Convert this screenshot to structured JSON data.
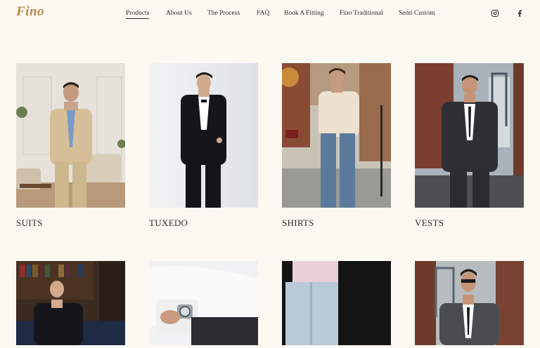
{
  "brand": {
    "logo_text": "Fino"
  },
  "nav": {
    "items": [
      {
        "label": "Products",
        "active": true
      },
      {
        "label": "About Us"
      },
      {
        "label": "The Process"
      },
      {
        "label": "FAQ"
      },
      {
        "label": "Book A Fitting"
      },
      {
        "label": "Fino Traditional"
      },
      {
        "label": "Semi Custom"
      }
    ]
  },
  "social": {
    "icons": [
      "instagram-icon",
      "facebook-icon"
    ]
  },
  "products": [
    {
      "label": "SUITS",
      "image": "man in beige suit, light blue shirt and blue tie in a white living room"
    },
    {
      "label": "TUXEDO",
      "image": "man in black tuxedo with bow tie against a light backdrop"
    },
    {
      "label": "SHIRTS",
      "image": "man in cream shirt and blue jeans on a city street"
    },
    {
      "label": "VESTS",
      "image": "man in charcoal three-piece suit with a bridge behind"
    },
    {
      "label": "",
      "image": "man in dark velvet jacket in a library"
    },
    {
      "label": "",
      "image": "close-up of white shirt sleeve and wrist watch"
    },
    {
      "label": "",
      "image": "pink shirt and light jeans against a dark background"
    },
    {
      "label": "",
      "image": "man in grey suit and sunglasses on a city street"
    }
  ],
  "colors": {
    "background": "#fcf9f3",
    "brand": "#b58a45",
    "text": "#2a2a2a"
  }
}
